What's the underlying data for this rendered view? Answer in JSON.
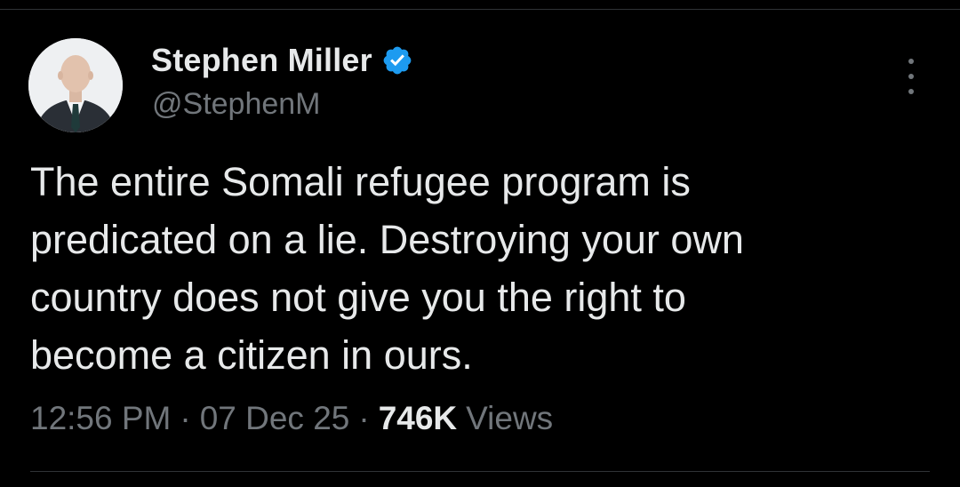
{
  "tweet": {
    "author": {
      "display_name": "Stephen Miller",
      "handle": "@StephenM",
      "verified": true,
      "verified_color": "#1d9bf0"
    },
    "text": "The entire Somali refugee program is\npredicated on a lie. Destroying your own\ncountry does not give you the right to\nbecome a citizen in ours.",
    "meta": {
      "time": "12:56 PM",
      "separator": "·",
      "date": "07 Dec 25",
      "views_count": "746K",
      "views_label": "Views"
    }
  },
  "icons": {
    "avatar": "profile-photo",
    "verified": "verified-badge-icon",
    "more": "more-options-icon"
  },
  "colors": {
    "background": "#000000",
    "primary_text": "#e7e9ea",
    "secondary_text": "#71767b",
    "divider": "#2f3336"
  }
}
